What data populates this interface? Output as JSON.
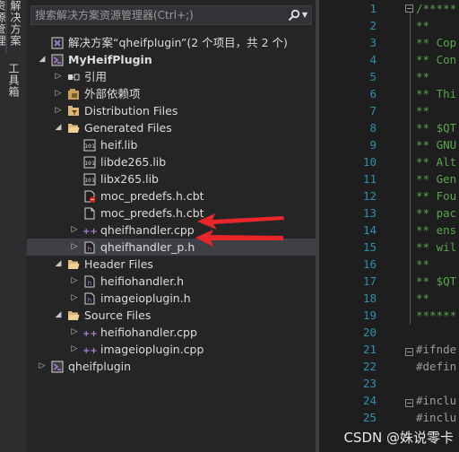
{
  "side_tabs": {
    "solution_explorer": "解决方案资源管理器",
    "toolbox": "工具箱"
  },
  "search": {
    "placeholder": "搜索解决方案资源管理器(Ctrl+;)"
  },
  "tree": [
    {
      "label": "解决方案“qheifplugin”(2 个项目，共 2 个)",
      "icon": "solution-icon",
      "depth": 0,
      "arrow": ""
    },
    {
      "label": "MyHeifPlugin",
      "icon": "project-icon",
      "depth": 0,
      "arrow": "expanded",
      "bold": true
    },
    {
      "label": "引用",
      "icon": "references-icon",
      "depth": 1,
      "arrow": "collapsed"
    },
    {
      "label": "外部依赖项",
      "icon": "external-deps-icon",
      "depth": 1,
      "arrow": "collapsed"
    },
    {
      "label": "Distribution Files",
      "icon": "filter-icon",
      "depth": 1,
      "arrow": "collapsed"
    },
    {
      "label": "Generated Files",
      "icon": "folder-open-icon",
      "depth": 1,
      "arrow": "expanded"
    },
    {
      "label": "heif.lib",
      "icon": "lib-icon",
      "depth": 2,
      "arrow": ""
    },
    {
      "label": "libde265.lib",
      "icon": "lib-icon",
      "depth": 2,
      "arrow": ""
    },
    {
      "label": "libx265.lib",
      "icon": "lib-icon",
      "depth": 2,
      "arrow": ""
    },
    {
      "label": "moc_predefs.h.cbt",
      "icon": "excluded-file-icon",
      "depth": 2,
      "arrow": ""
    },
    {
      "label": "moc_predefs.h.cbt",
      "icon": "file-icon",
      "depth": 2,
      "arrow": ""
    },
    {
      "label": "qheifhandler.cpp",
      "icon": "cpp-icon",
      "depth": 2,
      "arrow": "collapsed"
    },
    {
      "label": "qheifhandler_p.h",
      "icon": "header-icon",
      "depth": 2,
      "arrow": "collapsed",
      "selected": true
    },
    {
      "label": "Header Files",
      "icon": "folder-open-icon",
      "depth": 1,
      "arrow": "expanded"
    },
    {
      "label": "heifiohandler.h",
      "icon": "header-icon",
      "depth": 2,
      "arrow": "collapsed"
    },
    {
      "label": "imageioplugin.h",
      "icon": "header-icon",
      "depth": 2,
      "arrow": "collapsed"
    },
    {
      "label": "Source Files",
      "icon": "folder-open-icon",
      "depth": 1,
      "arrow": "expanded"
    },
    {
      "label": "heifiohandler.cpp",
      "icon": "cpp-icon",
      "depth": 2,
      "arrow": "collapsed"
    },
    {
      "label": "imageioplugin.cpp",
      "icon": "cpp-icon",
      "depth": 2,
      "arrow": "collapsed"
    },
    {
      "label": "qheifplugin",
      "icon": "project-icon",
      "depth": 0,
      "arrow": "collapsed"
    }
  ],
  "editor": {
    "lines": [
      {
        "n": "1",
        "text": "/*****",
        "kind": "comment"
      },
      {
        "n": "2",
        "text": "**",
        "kind": "comment"
      },
      {
        "n": "3",
        "text": "** Cop",
        "kind": "comment"
      },
      {
        "n": "4",
        "text": "** Con",
        "kind": "comment"
      },
      {
        "n": "5",
        "text": "**",
        "kind": "comment"
      },
      {
        "n": "6",
        "text": "** Thi",
        "kind": "comment"
      },
      {
        "n": "7",
        "text": "**",
        "kind": "comment"
      },
      {
        "n": "8",
        "text": "** $QT",
        "kind": "comment"
      },
      {
        "n": "9",
        "text": "** GNU",
        "kind": "comment"
      },
      {
        "n": "10",
        "text": "** Alt",
        "kind": "comment"
      },
      {
        "n": "11",
        "text": "** Gen",
        "kind": "comment"
      },
      {
        "n": "12",
        "text": "** Fou",
        "kind": "comment"
      },
      {
        "n": "13",
        "text": "** pac",
        "kind": "comment"
      },
      {
        "n": "14",
        "text": "** ens",
        "kind": "comment"
      },
      {
        "n": "15",
        "text": "** wil",
        "kind": "comment"
      },
      {
        "n": "16",
        "text": "**",
        "kind": "comment"
      },
      {
        "n": "17",
        "text": "** $QT",
        "kind": "comment"
      },
      {
        "n": "18",
        "text": "**",
        "kind": "comment"
      },
      {
        "n": "19",
        "text": "******",
        "kind": "comment"
      },
      {
        "n": "20",
        "text": "",
        "kind": "comment"
      },
      {
        "n": "21",
        "text": "#ifnde",
        "kind": "pp"
      },
      {
        "n": "22",
        "text": "#defin",
        "kind": "pp"
      },
      {
        "n": "23",
        "text": "",
        "kind": "pp"
      },
      {
        "n": "24",
        "text": "#inclu",
        "kind": "pp"
      },
      {
        "n": "25",
        "text": "#inclu",
        "kind": "pp"
      }
    ]
  },
  "watermark": "CSDN @姝说零卡",
  "colors": {
    "arrow": "#e8262a",
    "line_numbers": "#2b91af",
    "comment": "#57a64a"
  }
}
